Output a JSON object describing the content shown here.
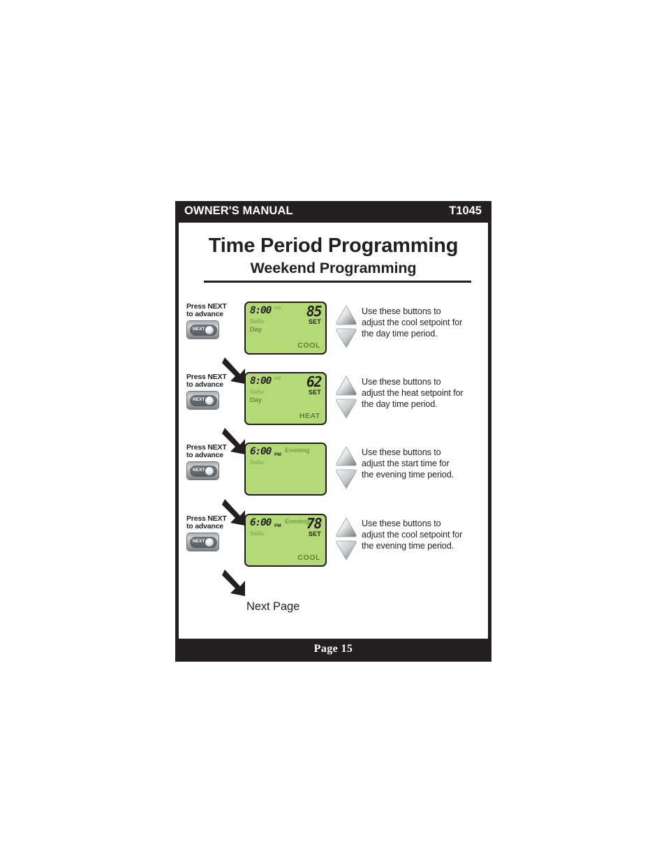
{
  "header": {
    "manual_label": "OWNER'S MANUAL",
    "model": "T1045"
  },
  "titles": {
    "main": "Time Period Programming",
    "sub": "Weekend Programming"
  },
  "footer": {
    "page": "Page 15"
  },
  "next_page_label": "Next Page",
  "press_next": {
    "line1_prefix": "Press ",
    "line1_keyword": "NEXT",
    "line2": "to advance",
    "button_label": "NEXT"
  },
  "colors": {
    "frame": "#231f20",
    "lcd_background": "#b4d977",
    "lcd_active_text": "#231f20",
    "lcd_inactive_text": "#8fae5e",
    "button_gray": "#a9adb0"
  },
  "steps": [
    {
      "id": "step-1-day-cool",
      "display": {
        "time": "8:00",
        "ampm": "AM",
        "ampm_active": false,
        "days": "SaSu",
        "period_left": "Day",
        "period_top": "",
        "setpoint": "85",
        "set_label": "SET",
        "mode": "COOL"
      },
      "instruction": [
        "Use these buttons to",
        "adjust the cool setpoint for",
        "the day time period."
      ]
    },
    {
      "id": "step-2-day-heat",
      "display": {
        "time": "8:00",
        "ampm": "AM",
        "ampm_active": false,
        "days": "SaSu",
        "period_left": "Day",
        "period_top": "",
        "setpoint": "62",
        "set_label": "SET",
        "mode": "HEAT"
      },
      "instruction": [
        "Use these buttons to",
        "adjust the heat setpoint for",
        "the day time period."
      ]
    },
    {
      "id": "step-3-evening-time",
      "display": {
        "time": "6:00",
        "ampm": "PM",
        "ampm_active": true,
        "days": "SaSu",
        "period_left": "",
        "period_top": "Evening",
        "setpoint": "",
        "set_label": "",
        "mode": ""
      },
      "instruction": [
        "Use these buttons to",
        "adjust the start time for",
        "the evening time period."
      ]
    },
    {
      "id": "step-4-evening-cool",
      "display": {
        "time": "6:00",
        "ampm": "PM",
        "ampm_active": true,
        "days": "SaSu",
        "period_left": "",
        "period_top": "Evening",
        "setpoint": "78",
        "set_label": "SET",
        "mode": "COOL"
      },
      "instruction": [
        "Use these buttons to",
        "adjust the cool setpoint for",
        "the evening time period."
      ]
    }
  ]
}
